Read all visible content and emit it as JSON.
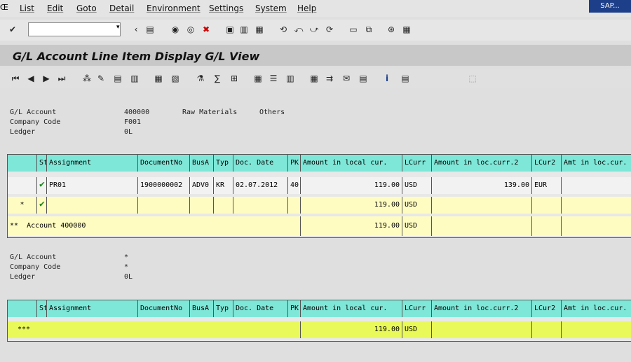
{
  "menu": {
    "sap_label": "Œ",
    "items": [
      "List",
      "Edit",
      "Goto",
      "Detail",
      "Environment",
      "Settings",
      "System",
      "Help"
    ],
    "sap_button": "SAP..."
  },
  "title": "G/L Account Line Item Display G/L View",
  "section1": {
    "header_labels": [
      "G/L Account",
      "Company Code",
      "Ledger"
    ],
    "header_values": [
      "400000",
      "F001",
      "0L"
    ],
    "account_desc": "Raw Materials",
    "account_extra": "Others",
    "columns": [
      "St",
      "Assignment",
      "DocumentNo",
      "BusA",
      "Typ",
      "Doc. Date",
      "PK",
      "Amount in local cur.",
      "LCurr",
      "Amount in loc.curr.2",
      "LCur2",
      "Amt in loc.cur."
    ],
    "rows": [
      {
        "status": "✔",
        "assignment": "PR01",
        "docno": "1900000002",
        "busa": "ADV0",
        "typ": "KR",
        "docdate": "02.07.2012",
        "pk": "40",
        "amount": "119.00",
        "lcurr": "USD",
        "amount2": "139.00",
        "lcur2": "EUR",
        "amt3": "",
        "type": "white"
      },
      {
        "marker": "*",
        "status": "✔",
        "assignment": "",
        "docno": "",
        "busa": "",
        "typ": "",
        "docdate": "",
        "pk": "",
        "amount": "119.00",
        "lcurr": "USD",
        "amount2": "",
        "lcur2": "",
        "amt3": "",
        "type": "yellow"
      },
      {
        "marker": "**",
        "assignment": "Account 400000",
        "amount": "119.00",
        "lcurr": "USD",
        "type": "yellow"
      }
    ]
  },
  "section2": {
    "header_labels": [
      "G/L Account",
      "Company Code",
      "Ledger"
    ],
    "header_values": [
      "*",
      "*",
      "0L"
    ],
    "columns": [
      "St",
      "Assignment",
      "DocumentNo",
      "BusA",
      "Typ",
      "Doc. Date",
      "PK",
      "Amount in local cur.",
      "LCurr",
      "Amount in loc.curr.2",
      "LCur2",
      "Amt in loc.cur."
    ],
    "total_row": {
      "marker": "***",
      "amount": "119.00",
      "lcurr": "USD"
    }
  },
  "icons": {
    "std_toolbar": [
      "enter-icon",
      "save-icon",
      "back-icon",
      "exit-icon",
      "cancel-icon",
      "print-icon",
      "find-icon",
      "find-next-icon",
      "first-page-icon",
      "prev-page-icon",
      "next-page-icon",
      "last-page-icon",
      "new-session-icon",
      "shortcut-icon",
      "help-icon",
      "customize-icon"
    ],
    "app_toolbar": [
      "first-item-icon",
      "prev-item-icon",
      "next-item-icon",
      "last-item-icon",
      "select-icon",
      "edit-icon",
      "display-doc-icon",
      "change-doc-icon",
      "filter-icon",
      "sort-asc-icon",
      "sort-desc-icon",
      "total-icon",
      "subtotal-icon",
      "layout-icon",
      "select-layout-icon",
      "save-layout-icon",
      "grid-icon",
      "export-icon",
      "info-icon",
      "display-variant-icon"
    ]
  },
  "colors": {
    "header_cell": "#7fe7d8",
    "total_row": "#fffcc2",
    "grand_total_row": "#e9f95a",
    "title_bar": "#c8c8c8",
    "check": "#1a8a1a"
  }
}
